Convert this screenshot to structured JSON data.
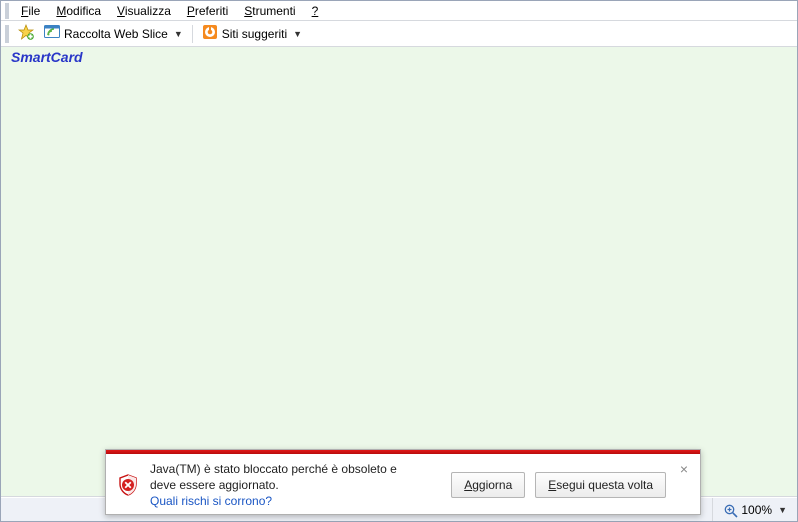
{
  "menu": {
    "file": "File",
    "file_u": "F",
    "modifica": "Modifica",
    "modifica_u": "M",
    "visualizza": "Visualizza",
    "visualizza_u": "V",
    "preferiti": "Preferiti",
    "preferiti_u": "P",
    "strumenti": "Strumenti",
    "strumenti_u": "S",
    "help": "?",
    "help_u": "?"
  },
  "toolbar": {
    "webslice_label": "Raccolta Web Slice",
    "siti_label": "Siti suggeriti"
  },
  "content": {
    "title": "SmartCard"
  },
  "notify": {
    "line1": "Java(TM) è stato bloccato perché è obsoleto e",
    "line2": "deve essere aggiornato.",
    "link": "Quali rischi si corrono?",
    "aggiorna": "Aggiorna",
    "aggiorna_u": "A",
    "esegui": "Esegui questa volta",
    "esegui_u": "E"
  },
  "status": {
    "zoom": "100%"
  },
  "colors": {
    "content_bg": "#ecf8e9",
    "title_color": "#2936c8",
    "notify_red": "#c81414",
    "link_blue": "#1a56c4"
  }
}
